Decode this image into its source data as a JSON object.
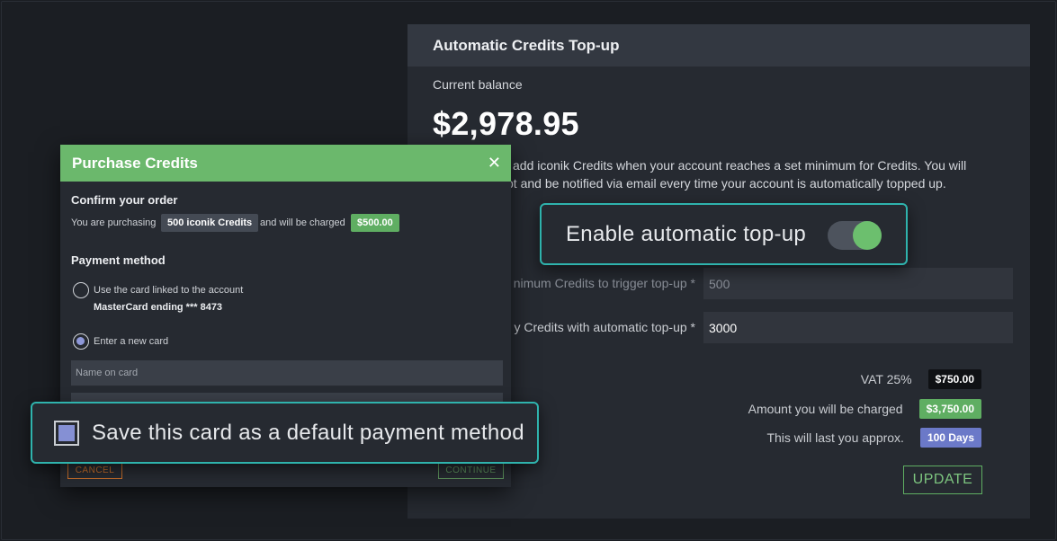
{
  "topup": {
    "title": "Automatic Credits Top-up",
    "balance_label": "Current balance",
    "balance_value": "$2,978.95",
    "description": "add iconik Credits when your account reaches a set minimum for Credits. You will\npt and be notified via email every time your account is automatically topped up.",
    "enable_label": "Enable automatic top-up",
    "enable_on": true,
    "min_label": "nimum Credits to trigger top-up *",
    "min_value": "500",
    "buy_label": "y Credits with automatic top-up *",
    "buy_value": "3000",
    "vat_label": "VAT 25%",
    "vat_value": "$750.00",
    "charge_label": "Amount you will be charged",
    "charge_value": "$3,750.00",
    "last_label": "This will last you approx.",
    "last_value": "100 Days",
    "update_label": "UPDATE"
  },
  "purchase": {
    "title": "Purchase Credits",
    "close_glyph": "✕",
    "confirm_heading": "Confirm your order",
    "purchasing_text": "You are purchasing",
    "credits_chip": "500 iconik Credits",
    "charged_text": "and will be charged",
    "price_chip": "$500.00",
    "payment_heading": "Payment method",
    "option_linked_label": "Use the card linked to the account",
    "option_linked_detail": "MasterCard ending *** 8473",
    "option_new_label": "Enter a new card",
    "name_placeholder": "Name on card",
    "save_label": "Save this card as a default payment method",
    "save_checked": true,
    "cancel_label": "CANCEL",
    "continue_label": "CONTINUE"
  },
  "colors": {
    "accent_green": "#6bb86c",
    "callout_teal": "#2fb3ad",
    "tag_blue": "#6b79c8",
    "cancel_orange": "#c46d2b"
  }
}
